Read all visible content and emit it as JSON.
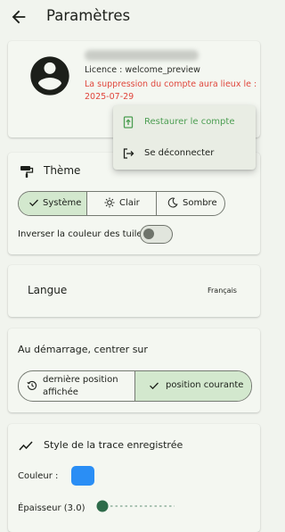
{
  "appbar": {
    "title": "Paramètres",
    "back_icon": "arrow-back-icon"
  },
  "account": {
    "avatar_icon": "account-circle-icon",
    "licence": "Licence : welcome_preview",
    "deletion_notice": "La suppression du compte aura lieux le : 2025-07-29",
    "menu_icon": "more-vert-icon"
  },
  "account_menu": {
    "items": [
      {
        "label": "Restaurer le compte",
        "icon": "restore-upload-icon",
        "color": "#4c9e52"
      },
      {
        "label": "Se déconnecter",
        "icon": "logout-icon"
      }
    ]
  },
  "theme": {
    "title": "Thème",
    "icon": "paint-roller-icon",
    "options": [
      {
        "label": "Système",
        "icon": "check-icon",
        "selected": true
      },
      {
        "label": "Clair",
        "icon": "sun-icon",
        "selected": false
      },
      {
        "label": "Sombre",
        "icon": "moon-icon",
        "selected": false
      }
    ],
    "invert_tiles_label": "Inverser la couleur des tuiles",
    "invert_tiles_on": false
  },
  "language": {
    "title": "Langue",
    "value": "Français"
  },
  "startup": {
    "title": "Au démarrage, centrer sur",
    "options": [
      {
        "label": "dernière position affichée",
        "icon": "history-icon",
        "selected": false
      },
      {
        "label": "position courante",
        "icon": "check-icon",
        "selected": true
      }
    ]
  },
  "trace": {
    "title": "Style de la trace enregistrée",
    "icon": "trending-line-icon",
    "color_label": "Couleur :",
    "color": "#2a8ef5",
    "thickness_label": "Épaisseur (3.0)",
    "thickness_value": 3.0,
    "thickness_slider_fraction": 0.0
  },
  "colors": {
    "accent_selected": "#d3e8ce",
    "warning": "#e0463c",
    "slider": "#2e6b4a"
  }
}
